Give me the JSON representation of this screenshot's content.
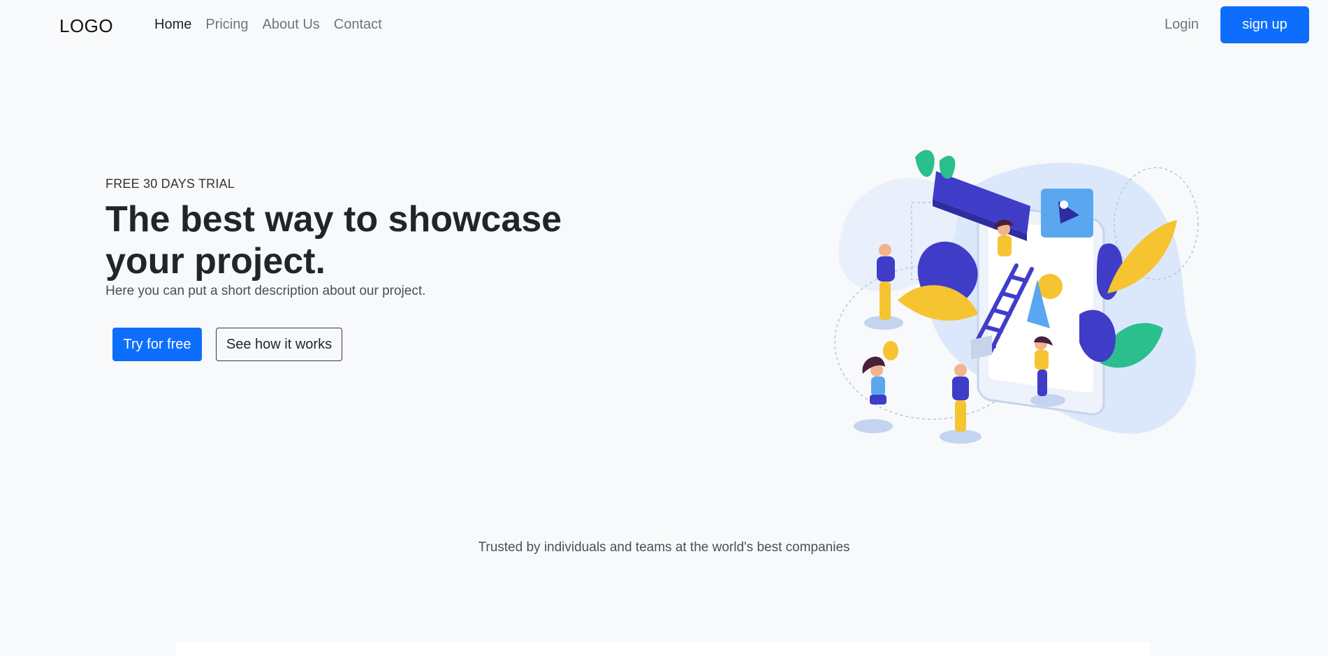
{
  "nav": {
    "logo": "LOGO",
    "links": [
      {
        "label": "Home",
        "active": true
      },
      {
        "label": "Pricing",
        "active": false
      },
      {
        "label": "About Us",
        "active": false
      },
      {
        "label": "Contact",
        "active": false
      }
    ],
    "login_label": "Login",
    "signup_label": "sign up"
  },
  "hero": {
    "eyebrow": "FREE 30 DAYS TRIAL",
    "title": "The best way to showcase your project.",
    "description": "Here you can put a short description about our project.",
    "primary_cta": "Try for free",
    "secondary_cta": "See how it works"
  },
  "trusted": {
    "text": "Trusted by individuals and teams at the world's best companies"
  },
  "colors": {
    "accent": "#0d6efd",
    "background": "#f8f9fa",
    "illustration_purple": "#3f3dc8",
    "illustration_yellow": "#f6c431",
    "illustration_green": "#2cbf8e",
    "illustration_light_blue": "#dbe8fb"
  }
}
